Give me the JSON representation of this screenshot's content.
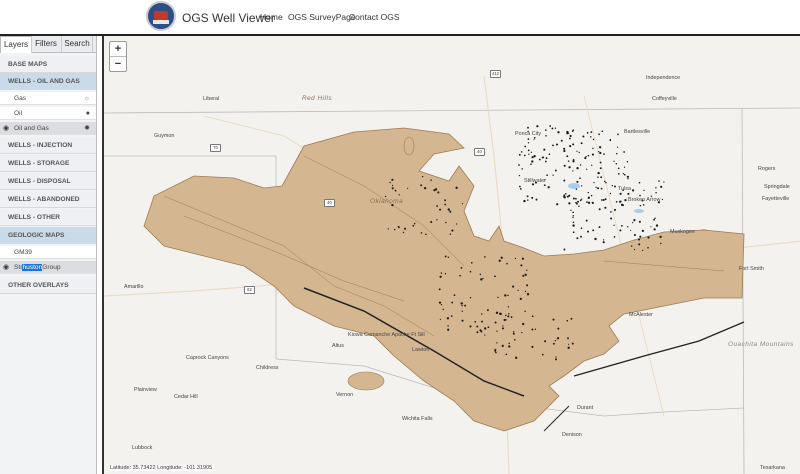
{
  "header": {
    "app_title": "OGS Well Viewer",
    "nav": [
      "Home",
      "OGS SurveyPage",
      "Contact OGS"
    ]
  },
  "sidebar": {
    "tabs": [
      "Layers",
      "Filters",
      "Search"
    ],
    "sections": {
      "base_maps": "BASE MAPS",
      "wells_oil_gas": "WELLS - OIL AND GAS",
      "wells_injection": "WELLS - INJECTION",
      "wells_storage": "WELLS - STORAGE",
      "wells_disposal": "WELLS - DISPOSAL",
      "wells_abandoned": "WELLS - ABANDONED",
      "wells_other": "WELLS - OTHER",
      "geologic_maps": "GEOLOGIC MAPS",
      "other_overlays": "OTHER OVERLAYS"
    },
    "items": {
      "gas": "Gas",
      "oil": "Oil",
      "oil_and_gas": "Oil and Gas",
      "gm39": "GM39",
      "strat_pre": "Str",
      "strat_highlight": "huston",
      "strat_post": "Group"
    }
  },
  "map": {
    "zoom_in": "+",
    "zoom_out": "−",
    "coordinates": "Latitude: 35.73422 Longitude: -101.31905",
    "regions": {
      "red_hills": "Red Hills",
      "oklahoma": "Oklahoma",
      "ouachita": "Ouachita Mountains"
    },
    "places": {
      "independence": "Independence",
      "coffeyville": "Coffeyville",
      "liberal": "Liberal",
      "guymon": "Guymon",
      "bartlesville": "Bartlesville",
      "ponca_city": "Ponca City",
      "stillwater": "Stillwater",
      "tulsa": "Tulsa",
      "broken_arrow": "Broken Arrow",
      "muskogee": "Muskogee",
      "rogers": "Rogers",
      "springdale": "Springdale",
      "fayetteville": "Fayetteville",
      "fort_smith": "Fort Smith",
      "amarillo": "Amarillo",
      "mcalester": "McAlester",
      "altus": "Altus",
      "lawton": "Lawton",
      "vernon": "Vernon",
      "childress": "Childress",
      "wichita_falls": "Wichita Falls",
      "durant": "Durant",
      "denison": "Denison",
      "plainview": "Plainview",
      "cedar_hill": "Cedar Hill",
      "lubbock": "Lubbock",
      "texarkana": "Texarkana",
      "caprock": "Caprock Canyons",
      "kiowa": "Kiowa Comanche Apache Ft Sill"
    },
    "highways": [
      "70",
      "40",
      "40",
      "62",
      "412"
    ],
    "colors": {
      "geology_fill": "#d4b690",
      "geology_stroke": "#9c7b55",
      "map_bg": "#f4f2ee",
      "water": "#aacdee",
      "sidebar_highlight": "#c9dbe8"
    }
  }
}
